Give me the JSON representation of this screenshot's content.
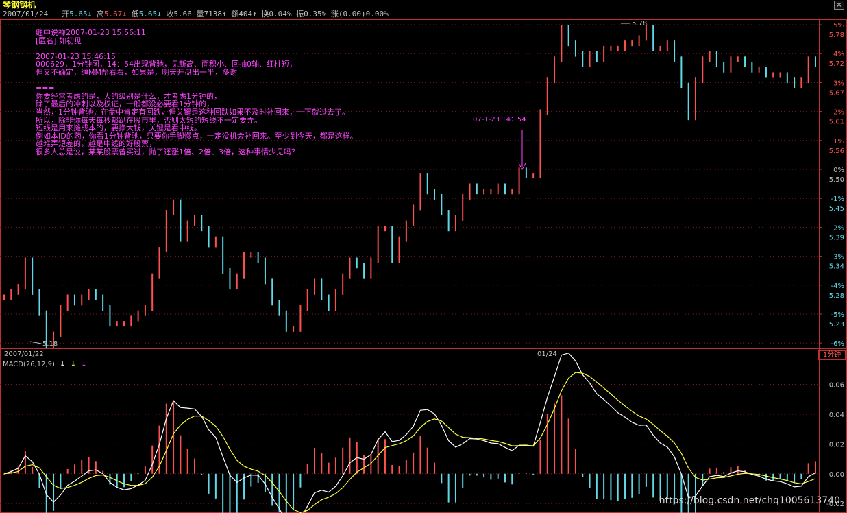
{
  "app_title": "琴钢钢机",
  "info_bar": {
    "date": "2007/01/24",
    "open_label": "开",
    "open": "5.65",
    "open_arrow": "↓",
    "high_label": "高",
    "high": "5.67",
    "high_arrow": "↓",
    "low_label": "低",
    "low": "5.65",
    "low_arrow": "↓",
    "close_label": "收",
    "close": "5.66",
    "vol_label": "量",
    "vol": "7138",
    "vol_arrow": "↑",
    "amt_label": "额",
    "amt": "404",
    "amt_arrow": "↑",
    "turnover_label": "换",
    "turnover": "0.04%",
    "amp_label": "振",
    "amp": "0.35%",
    "chg_label": "涨",
    "chg": "(0.00)0.00%"
  },
  "notes": [
    "缠中说禅2007-01-23 15:56:11",
    "[匿名] 如初见",
    "",
    "2007-01-23 15:46:15",
    "000629，1分钟图，14：54出现背驰，见新高、面积小、回抽0轴、红柱短，",
    "但又不确定，缠MM帮看看，如果是，明天开盘出一半，多谢",
    "",
    "===",
    "你要经常考虑的是，大的级别是什么，才考虑1分钟的，",
    "除了最后的冲刺以及权证，一般都没必要看1分钟的，",
    "当然，1分钟背驰，在盘中肯定有回跌，但关键是这种回跌如果不及时补回来，一下就过去了。",
    "所以，除非你每天每秒都趴在股市里，否则太短的短线不一定要弄。",
    "短线是用来摊成本的，要挣大钱，关键是看中线。",
    "例如本ID的药，你看1分钟背驰，只要你手脚慢点，一定没机会补回来。至少到今天，都是这样。",
    "越难弄短差的，越是中线的好股票，",
    "很多人总是说，某某股票曾买过，抛了还涨1倍、2倍、3倍，这种事情少见吗？"
  ],
  "annotation_text": "07-1-23  14：54",
  "date_labels": {
    "left": "2007/01/22",
    "mid": "01/24"
  },
  "period_label": "1分钟",
  "macd_label": "MACD(26,12,9)",
  "macd_arrows": [
    "↓",
    "↓",
    "↓"
  ],
  "watermark": "https://blog.csdn.net/chq1005613740",
  "colors": {
    "up": "#ff5050",
    "down": "#60d8e8",
    "grid": "#801818",
    "axis": "#c03030",
    "note": "#ff44ff",
    "diff": "#ffffff",
    "dea": "#ffff40"
  },
  "chart_data": [
    {
      "type": "line",
      "name": "price",
      "ylim": [
        5.2,
        5.8
      ],
      "price_ticks": [
        "5.78",
        "5.72",
        "5.67",
        "5.61",
        "5.56",
        "5.50",
        "5.45",
        "5.39",
        "5.34",
        "5.28",
        "5.23"
      ],
      "pct_ticks": [
        "5%",
        "4%",
        "3%",
        "2%",
        "1%",
        "0%",
        "-1%",
        "-2%",
        "-3%",
        "-4%",
        "-5%",
        "-6%"
      ],
      "high_mark": "5.78",
      "low_mark": "5.18",
      "y": [
        5.27,
        5.28,
        5.29,
        5.34,
        5.28,
        5.24,
        5.18,
        5.2,
        5.25,
        5.27,
        5.26,
        5.27,
        5.28,
        5.27,
        5.25,
        5.22,
        5.22,
        5.22,
        5.23,
        5.24,
        5.25,
        5.31,
        5.36,
        5.43,
        5.45,
        5.38,
        5.41,
        5.42,
        5.4,
        5.37,
        5.38,
        5.32,
        5.29,
        5.31,
        5.35,
        5.35,
        5.34,
        5.3,
        5.26,
        5.24,
        5.21,
        5.21,
        5.25,
        5.28,
        5.3,
        5.27,
        5.25,
        5.28,
        5.31,
        5.34,
        5.33,
        5.31,
        5.34,
        5.4,
        5.4,
        5.34,
        5.38,
        5.41,
        5.44,
        5.5,
        5.47,
        5.46,
        5.43,
        5.4,
        5.42,
        5.46,
        5.48,
        5.47,
        5.47,
        5.47,
        5.48,
        5.47,
        5.47,
        5.51,
        5.5,
        5.5,
        5.62,
        5.68,
        5.72,
        5.78,
        5.75,
        5.73,
        5.71,
        5.73,
        5.72,
        5.74,
        5.74,
        5.74,
        5.75,
        5.75,
        5.76,
        5.78,
        5.74,
        5.74,
        5.75,
        5.72,
        5.67,
        5.61,
        5.68,
        5.72,
        5.73,
        5.71,
        5.7,
        5.72,
        5.72,
        5.71,
        5.7,
        5.7,
        5.69,
        5.69,
        5.69,
        5.68,
        5.67,
        5.68,
        5.72,
        5.71
      ]
    },
    {
      "type": "bar",
      "name": "MACD",
      "yticks": [
        "0.06",
        "0.04",
        "0.02",
        "0.00",
        "-0.02"
      ],
      "ylim": [
        -0.025,
        0.075
      ]
    }
  ]
}
